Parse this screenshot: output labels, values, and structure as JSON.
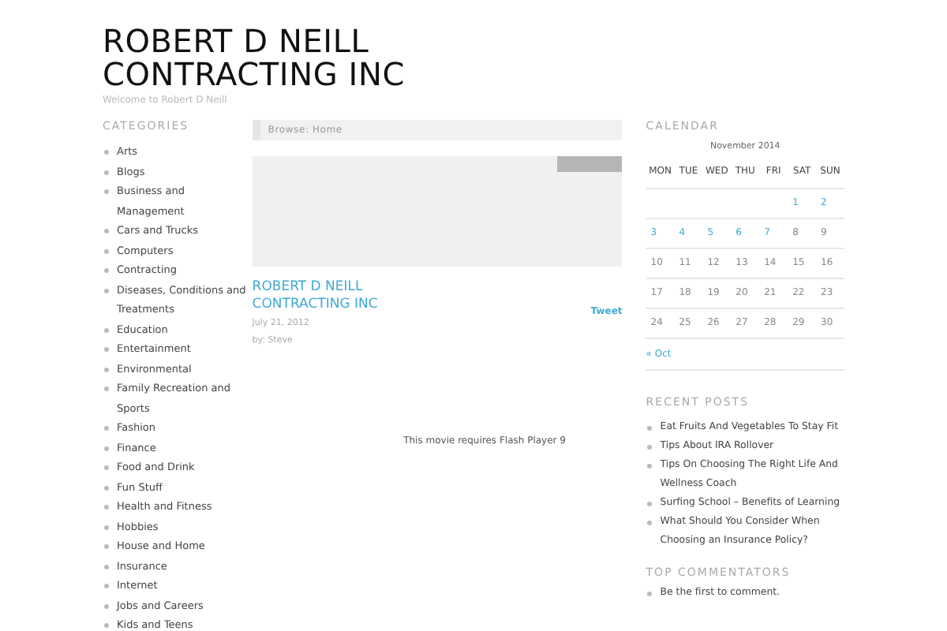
{
  "site": {
    "title": "ROBERT D NEILL CONTRACTING INC",
    "tagline": "Welcome to Robert D Neill"
  },
  "categories": {
    "heading": "CATEGORIES",
    "items": [
      "Arts",
      "Blogs",
      "Business and Management",
      "Cars and Trucks",
      "Computers",
      "Contracting",
      "Diseases, Conditions and Treatments",
      "Education",
      "Entertainment",
      "Environmental",
      "Family Recreation and Sports",
      "Fashion",
      "Finance",
      "Food and Drink",
      "Fun Stuff",
      "Health and Fitness",
      "Hobbies",
      "House and Home",
      "Insurance",
      "Internet",
      "Jobs and Careers",
      "Kids and Teens"
    ]
  },
  "breadcrumb": "Browse: Home",
  "post": {
    "title": "ROBERT D NEILL CONTRACTING INC",
    "date": "July 21, 2012",
    "author": "by: Steve",
    "tweet": "Tweet",
    "movie_message": "This movie requires Flash Player 9"
  },
  "calendar": {
    "heading": "CALENDAR",
    "caption": "November 2014",
    "weekdays": [
      "MON",
      "TUE",
      "WED",
      "THU",
      "FRI",
      "SAT",
      "SUN"
    ],
    "weeks": [
      [
        {
          "kind": "blank"
        },
        {
          "kind": "blank"
        },
        {
          "kind": "blank"
        },
        {
          "kind": "blank"
        },
        {
          "kind": "blank"
        },
        {
          "kind": "day",
          "day": "1",
          "linked": true
        },
        {
          "kind": "day",
          "day": "2",
          "linked": true
        }
      ],
      [
        {
          "kind": "day",
          "day": "3",
          "linked": true
        },
        {
          "kind": "day",
          "day": "4",
          "linked": true
        },
        {
          "kind": "day",
          "day": "5",
          "linked": true
        },
        {
          "kind": "day",
          "day": "6",
          "linked": true
        },
        {
          "kind": "day",
          "day": "7",
          "linked": true
        },
        {
          "kind": "day",
          "day": "8",
          "linked": false
        },
        {
          "kind": "day",
          "day": "9",
          "linked": false
        }
      ],
      [
        {
          "kind": "day",
          "day": "10",
          "linked": false
        },
        {
          "kind": "day",
          "day": "11",
          "linked": false
        },
        {
          "kind": "day",
          "day": "12",
          "linked": false
        },
        {
          "kind": "day",
          "day": "13",
          "linked": false
        },
        {
          "kind": "day",
          "day": "14",
          "linked": false
        },
        {
          "kind": "day",
          "day": "15",
          "linked": false
        },
        {
          "kind": "day",
          "day": "16",
          "linked": false
        }
      ],
      [
        {
          "kind": "day",
          "day": "17",
          "linked": false
        },
        {
          "kind": "day",
          "day": "18",
          "linked": false
        },
        {
          "kind": "day",
          "day": "19",
          "linked": false
        },
        {
          "kind": "day",
          "day": "20",
          "linked": false
        },
        {
          "kind": "day",
          "day": "21",
          "linked": false
        },
        {
          "kind": "day",
          "day": "22",
          "linked": false
        },
        {
          "kind": "day",
          "day": "23",
          "linked": false
        }
      ],
      [
        {
          "kind": "day",
          "day": "24",
          "linked": false
        },
        {
          "kind": "day",
          "day": "25",
          "linked": false
        },
        {
          "kind": "day",
          "day": "26",
          "linked": false
        },
        {
          "kind": "day",
          "day": "27",
          "linked": false
        },
        {
          "kind": "day",
          "day": "28",
          "linked": false
        },
        {
          "kind": "day",
          "day": "29",
          "linked": false
        },
        {
          "kind": "day",
          "day": "30",
          "linked": false
        }
      ]
    ],
    "prev": "« Oct"
  },
  "recent_posts": {
    "heading": "RECENT POSTS",
    "items": [
      "Eat Fruits And Vegetables To Stay Fit",
      "Tips About IRA Rollover",
      "Tips On Choosing The Right Life And Wellness Coach",
      "Surfing School – Benefits of Learning",
      "What Should You Consider When Choosing an Insurance Policy?"
    ]
  },
  "top_commentators": {
    "heading": "TOP COMMENTATORS",
    "items": [
      "Be the first to comment."
    ]
  }
}
